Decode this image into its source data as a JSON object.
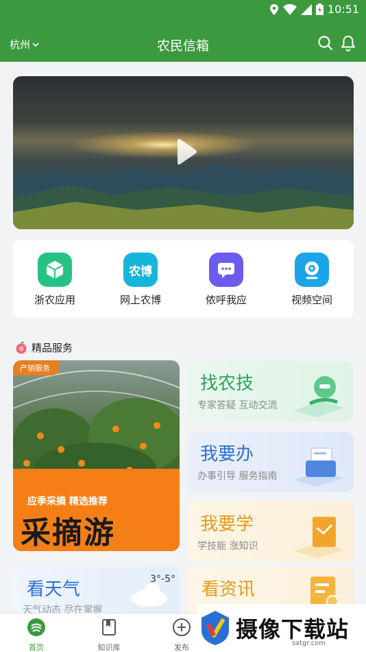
{
  "status": {
    "time": "10:51"
  },
  "header": {
    "city": "杭州",
    "title": "农民信箱"
  },
  "quick_links": [
    {
      "label": "浙农应用",
      "icon": "box-icon",
      "color": "#25c285"
    },
    {
      "label": "网上农博",
      "icon": "nongbo-icon",
      "icon_text": "农博",
      "color": "#16b6d9"
    },
    {
      "label": "侬呼我应",
      "icon": "chat-icon",
      "color": "#6b5cf0"
    },
    {
      "label": "视频空间",
      "icon": "camera-icon",
      "color": "#1aa5e8"
    }
  ],
  "section": {
    "title": "精品服务"
  },
  "featured": {
    "tag": "产销服务",
    "subtitle": "应季采摘  精选推荐",
    "title": "采摘游"
  },
  "services": [
    {
      "title": "找农技",
      "subtitle": "专家答疑 互动交流",
      "color": "#2aa55a"
    },
    {
      "title": "我要办",
      "subtitle": "办事引导 服务指南",
      "color": "#2f6fd6"
    },
    {
      "title": "我要学",
      "subtitle": "学技能 涨知识",
      "color": "#e89a1a"
    }
  ],
  "weather": {
    "title": "看天气",
    "subtitle": "天气动态 尽在掌握",
    "temp": "3°-5°"
  },
  "news": {
    "title": "看资讯"
  },
  "tabs": [
    {
      "label": "首页",
      "active": true
    },
    {
      "label": "知识库",
      "active": false
    },
    {
      "label": "发布",
      "active": false
    }
  ],
  "watermark": {
    "text": "摄像下载站",
    "url": "sxtgr.com"
  }
}
